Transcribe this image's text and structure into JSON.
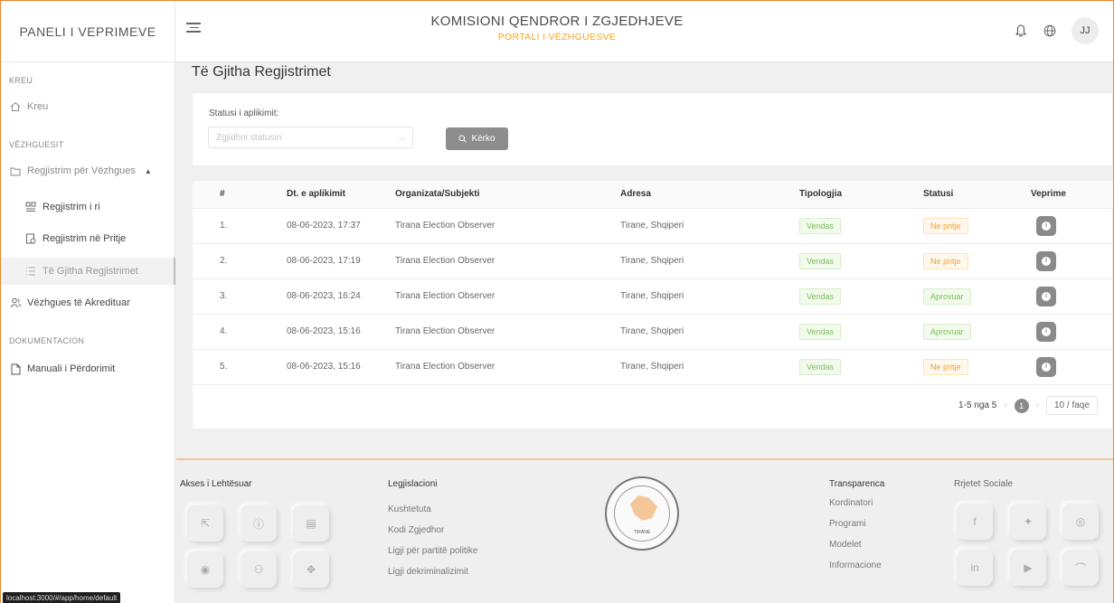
{
  "header": {
    "brand": "PANELI I VEPRIMEVE",
    "title": "KOMISIONI QENDROR I ZGJEDHJEVE",
    "subtitle": "PORTALI I VËZHGUESVE",
    "avatar_initials": "JJ"
  },
  "sidebar": {
    "section_home": "KREU",
    "home": "Kreu",
    "section_observers": "VËZHGUESIT",
    "registration": "Regjistrim për Vëzhgues",
    "new_registration": "Regjistrim i ri",
    "pending_registration": "Regjistrim në Pritje",
    "all_registrations": "Të Gjitha Regjistrimet",
    "accredited": "Vëzhgues të Akredituar",
    "section_docs": "DOKUMENTACION",
    "manual": "Manuali i Përdorimit"
  },
  "page": {
    "title": "Të Gjitha Regjistrimet"
  },
  "filter": {
    "label": "Statusi i aplikimit:",
    "placeholder": "Zgjidhni statusin",
    "search_label": "Kërko"
  },
  "table": {
    "headers": [
      "#",
      "Dt. e aplikimit",
      "Organizata/Subjekti",
      "Adresa",
      "Tipologjia",
      "Statusi",
      "Veprime"
    ],
    "rows": [
      {
        "num": "1.",
        "date": "08-06-2023, 17:37",
        "org": "Tirana Election Observer",
        "addr": "Tirane, Shqiperi",
        "type": "Vendas",
        "status": "Ne pritje"
      },
      {
        "num": "2.",
        "date": "08-06-2023, 17:19",
        "org": "Tirana Election Observer",
        "addr": "Tirane, Shqiperi",
        "type": "Vendas",
        "status": "Ne pritje"
      },
      {
        "num": "3.",
        "date": "08-06-2023, 16:24",
        "org": "Tirana Election Observer",
        "addr": "Tirane, Shqiperi",
        "type": "Vendas",
        "status": "Aprovuar"
      },
      {
        "num": "4.",
        "date": "08-06-2023, 15:16",
        "org": "Tirana Election Observer",
        "addr": "Tirane, Shqiperi",
        "type": "Vendas",
        "status": "Aprovuar"
      },
      {
        "num": "5.",
        "date": "08-06-2023, 15:16",
        "org": "Tirana Election Observer",
        "addr": "Tirane, Shqiperi",
        "type": "Vendas",
        "status": "Ne pritje"
      }
    ]
  },
  "pagination": {
    "range": "1-5 nga 5",
    "current_page": "1",
    "page_size": "10 / faqe"
  },
  "footer": {
    "accessibility_title": "Akses i Lehtësuar",
    "legislation_title": "Legjislacioni",
    "legislation_links": [
      "Kushtetuta",
      "Kodi Zgjedhor",
      "Ligji për partitë politike",
      "Ligji dekriminalizimit"
    ],
    "transparency_title": "Transparenca",
    "transparency_links": [
      "Kordinatori",
      "Programi",
      "Modelet",
      "Informacione"
    ],
    "social_title": "Rrjetet Sociale",
    "seal_text": "TIRANE"
  },
  "status_bar": {
    "url": "localhost:3000/#/app/home/default"
  },
  "colors": {
    "accent_orange": "#f5a623",
    "frame_border": "#e8892f",
    "tag_green": "#7bbf58",
    "tag_orange": "#f0a030",
    "button_gray": "#8d8d8d"
  }
}
